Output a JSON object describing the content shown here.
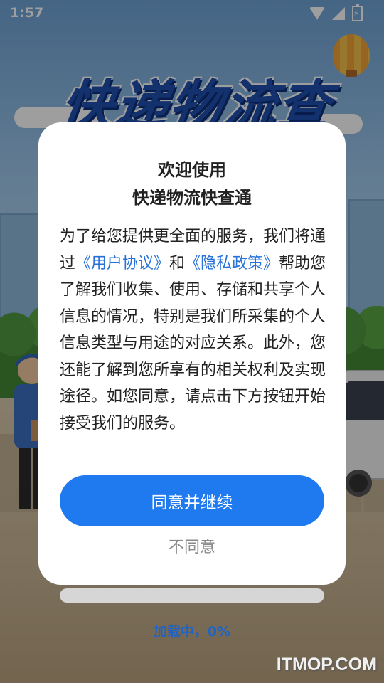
{
  "status_bar": {
    "time": "1:57",
    "icons": [
      "wifi-icon",
      "signal-icon",
      "battery-charging-icon"
    ]
  },
  "background": {
    "headline": "快递物流查"
  },
  "dialog": {
    "title_line1": "欢迎使用",
    "title_line2": "快递物流快查通",
    "body": {
      "part1": "为了给您提供更全面的服务，我们将通过",
      "link_user_agreement": "《用户协议》",
      "part2": "和",
      "link_privacy_policy": "《隐私政策》",
      "part3": "帮助您了解我们收集、使用、存储和共享个人信息的情况，特别是我们所采集的个人信息类型与用途的对应关系。此外，您还能了解到您所享有的相关权利及实现途径。如您同意，请点击下方按钮开始接受我们的服务。"
    },
    "agree_button": "同意并继续",
    "disagree_button": "不同意"
  },
  "loading": {
    "text": "加载中，0%",
    "progress_percent": 0
  },
  "watermark": "ITMOP.COM",
  "colors": {
    "accent": "#1f7af0",
    "link": "#2672d9",
    "loading_text": "#1f63c6"
  }
}
